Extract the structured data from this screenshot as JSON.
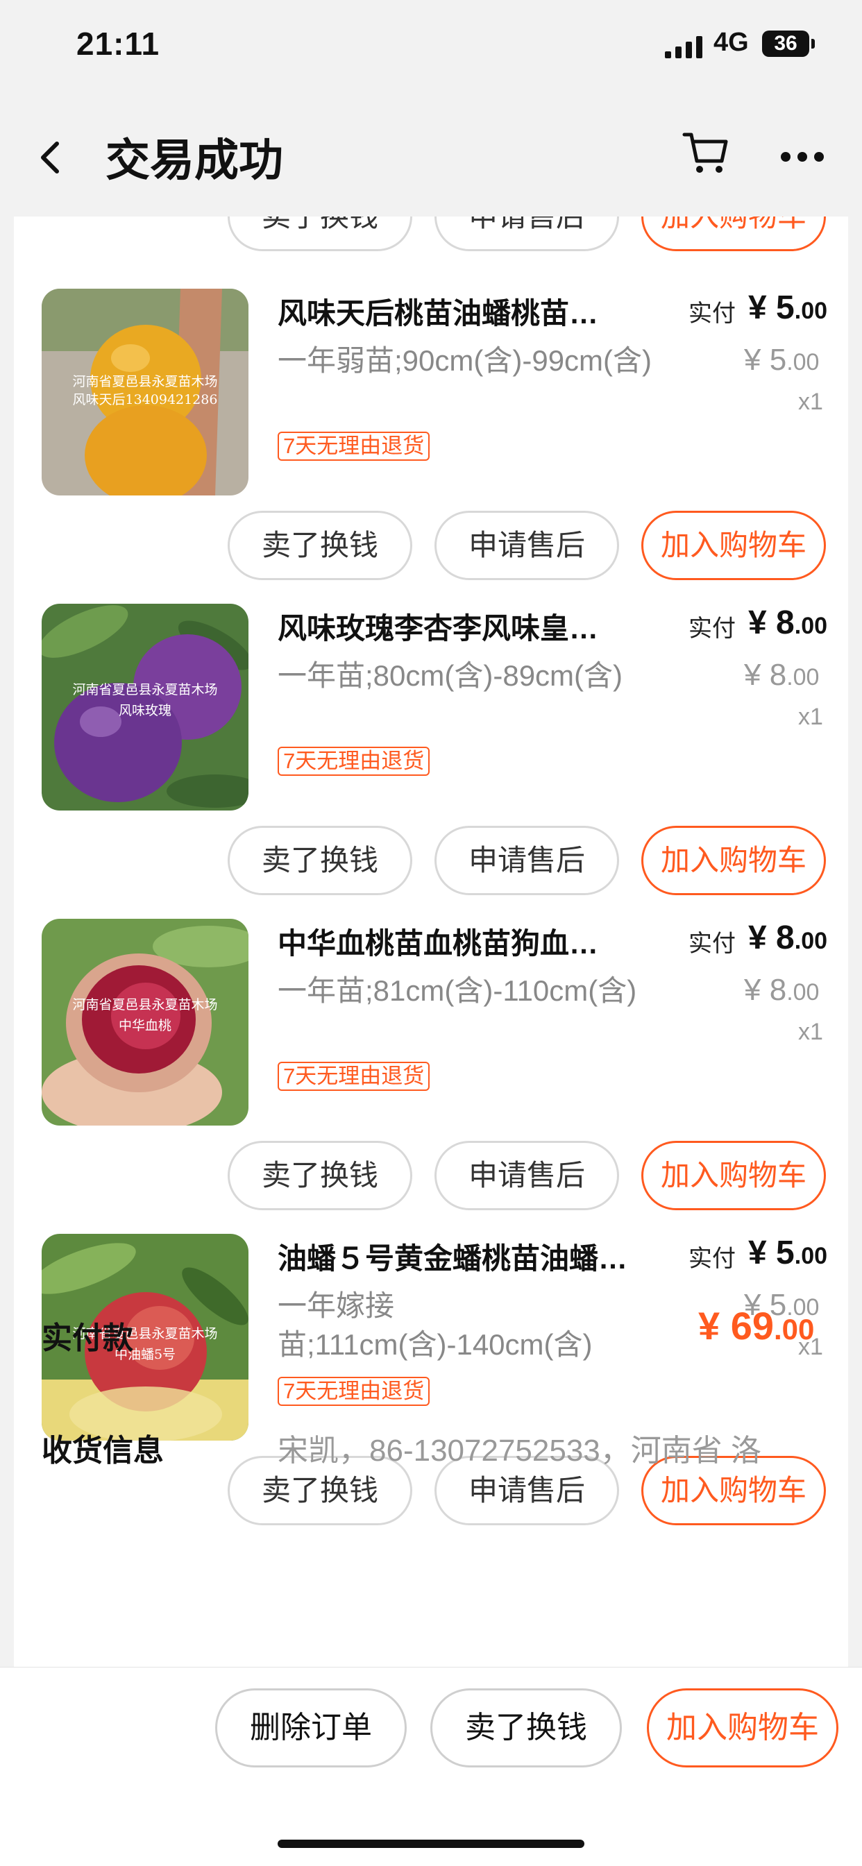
{
  "status_bar": {
    "time": "21:11",
    "network": "4G",
    "battery": "36"
  },
  "header": {
    "title": "交易成功"
  },
  "colors": {
    "accent": "#ff5a1f",
    "background": "#f2f2f2"
  },
  "actions": {
    "sell": "卖了换钱",
    "after_sale": "申请售后",
    "add_cart": "加入购物车"
  },
  "items": [
    {
      "name": "风味天后桃苗油蟠桃苗…",
      "paid_label": "实付",
      "currency": "¥",
      "paid_int": "5",
      "paid_dec": ".00",
      "spec": "一年弱苗;90cm(含)-99cm(含)",
      "orig_int": "5",
      "orig_dec": ".00",
      "qty": "x1",
      "tag": "7天无理由退货",
      "image_caption_1": "河南省夏邑县永夏苗木场",
      "image_caption_2": "风味天后13409421286"
    },
    {
      "name": "风味玫瑰李杏李风味皇…",
      "paid_label": "实付",
      "currency": "¥",
      "paid_int": "8",
      "paid_dec": ".00",
      "spec": "一年苗;80cm(含)-89cm(含)",
      "orig_int": "8",
      "orig_dec": ".00",
      "qty": "x1",
      "tag": "7天无理由退货",
      "image_caption_1": "河南省夏邑县永夏苗木场",
      "image_caption_2": "风味玫瑰"
    },
    {
      "name": "中华血桃苗血桃苗狗血…",
      "paid_label": "实付",
      "currency": "¥",
      "paid_int": "8",
      "paid_dec": ".00",
      "spec": "一年苗;81cm(含)-110cm(含)",
      "orig_int": "8",
      "orig_dec": ".00",
      "qty": "x1",
      "tag": "7天无理由退货",
      "image_caption_1": "河南省夏邑县永夏苗木场",
      "image_caption_2": "中华血桃"
    },
    {
      "name": "油蟠５号黄金蟠桃苗油蟠…",
      "paid_label": "实付",
      "currency": "¥",
      "paid_int": "5",
      "paid_dec": ".00",
      "spec": "一年嫁接苗;111cm(含)-140cm(含)",
      "orig_int": "5",
      "orig_dec": ".00",
      "qty": "x1",
      "tag": "7天无理由退货",
      "image_caption_1": "河南省夏邑县永夏苗木场",
      "image_caption_2": "中油蟠5号"
    }
  ],
  "summary": {
    "total_label": "实付款",
    "total_currency": "¥",
    "total_int": "69",
    "total_dec": ".00",
    "receiver_label": "收货信息",
    "receiver_value": "宋凯，86-13072752533，河南省 洛"
  },
  "bottom_bar": {
    "delete": "删除订单",
    "sell": "卖了换钱",
    "add_cart": "加入购物车"
  }
}
